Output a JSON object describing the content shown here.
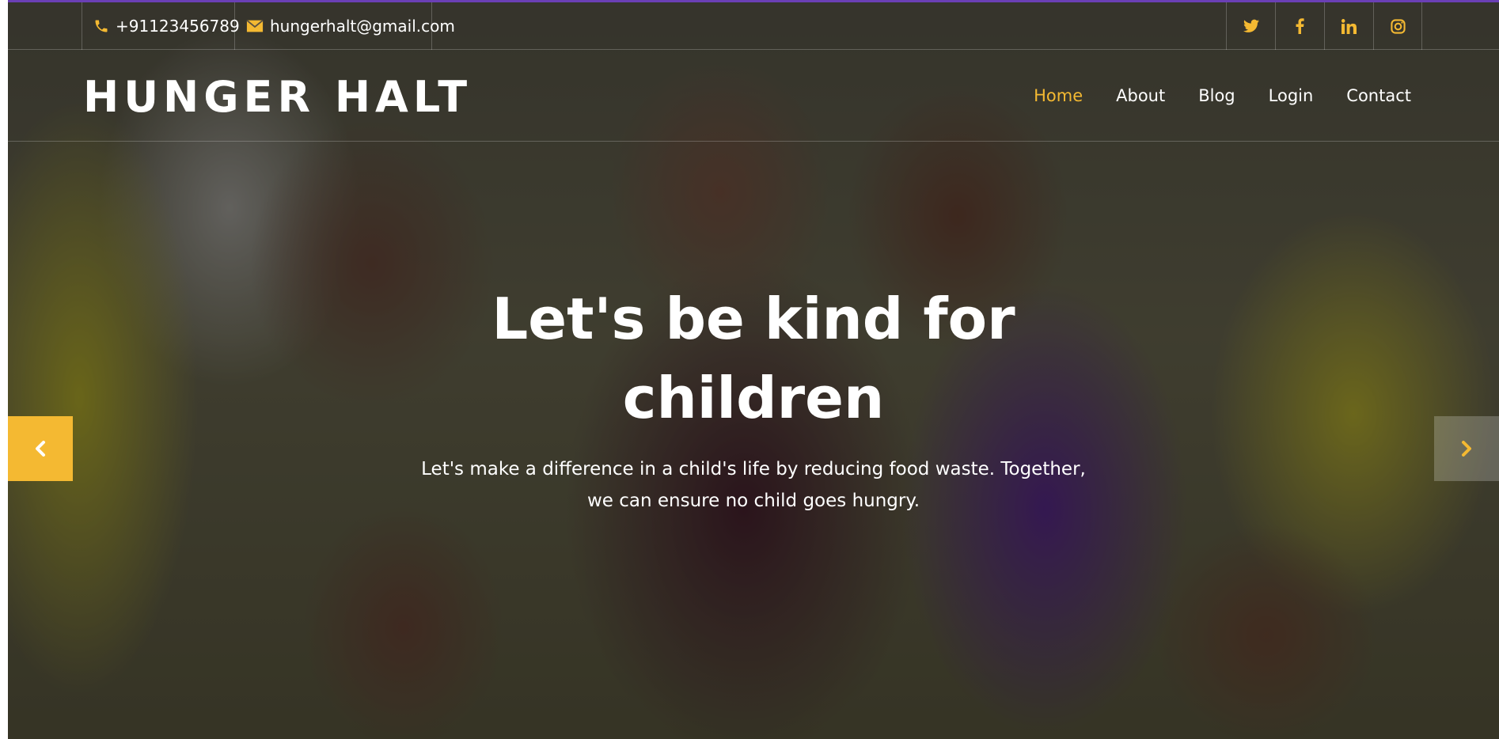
{
  "topbar": {
    "phone": "+91123456789",
    "email": "hungerhalt@gmail.com",
    "phone_icon": "phone-icon",
    "email_icon": "envelope-icon",
    "socials": [
      {
        "name": "twitter-icon",
        "glyph": "t"
      },
      {
        "name": "facebook-icon",
        "glyph": "f"
      },
      {
        "name": "linkedin-icon",
        "glyph": "in"
      },
      {
        "name": "instagram-icon",
        "glyph": "◎"
      }
    ]
  },
  "navbar": {
    "brand": "HUNGER HALT",
    "links": [
      {
        "label": "Home",
        "active": true
      },
      {
        "label": "About",
        "active": false
      },
      {
        "label": "Blog",
        "active": false
      },
      {
        "label": "Login",
        "active": false
      },
      {
        "label": "Contact",
        "active": false
      }
    ]
  },
  "hero": {
    "headline_line1": "Let's be kind for",
    "headline_line2": "children",
    "subtext_line1": "Let's make a difference in a child's life by reducing food waste. Together,",
    "subtext_line2": "we can ensure no child goes hungry.",
    "prev_icon": "chevron-left-icon",
    "next_icon": "chevron-right-icon"
  },
  "colors": {
    "accent": "#f4b932",
    "text": "#ffffff",
    "top_border": "#6a3fb5"
  }
}
